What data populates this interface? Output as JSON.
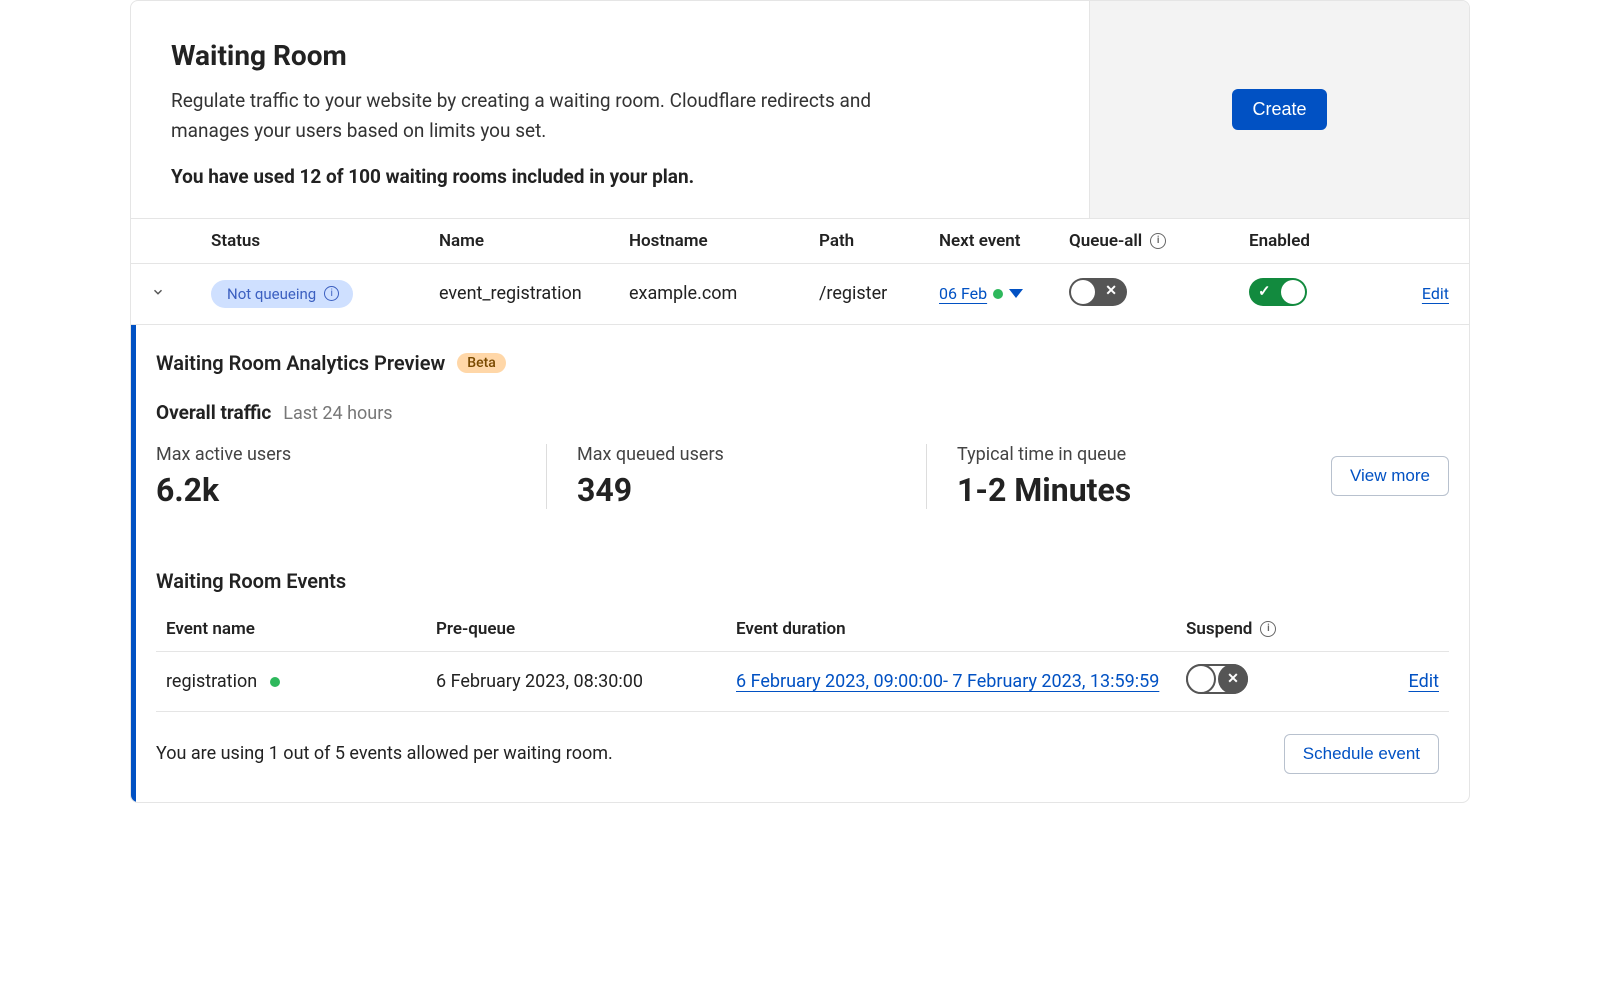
{
  "header": {
    "title": "Waiting Room",
    "description": "Regulate traffic to your website by creating a waiting room. Cloudflare redirects and manages your users based on limits you set.",
    "usage": "You have used 12 of 100 waiting rooms included in your plan.",
    "create_label": "Create"
  },
  "columns": {
    "status": "Status",
    "name": "Name",
    "hostname": "Hostname",
    "path": "Path",
    "next_event": "Next event",
    "queue_all": "Queue-all",
    "enabled": "Enabled",
    "edit": "Edit"
  },
  "room": {
    "status": "Not queueing",
    "name": "event_registration",
    "hostname": "example.com",
    "path": "/register",
    "next_event": "06 Feb",
    "queue_all_on": false,
    "enabled_on": true,
    "edit": "Edit"
  },
  "analytics": {
    "title": "Waiting Room Analytics Preview",
    "beta": "Beta",
    "overall_label": "Overall traffic",
    "overall_range": "Last 24 hours",
    "metrics": {
      "max_active_label": "Max active users",
      "max_active_value": "6.2k",
      "max_queued_label": "Max queued users",
      "max_queued_value": "349",
      "typical_label": "Typical time in queue",
      "typical_value": "1-2 Minutes"
    },
    "view_more": "View more"
  },
  "events_section": {
    "title": "Waiting Room Events",
    "columns": {
      "name": "Event name",
      "prequeue": "Pre-queue",
      "duration": "Event duration",
      "suspend": "Suspend"
    },
    "row": {
      "name": "registration",
      "prequeue": "6 February 2023, 08:30:00",
      "duration": "6 February 2023, 09:00:00- 7 February 2023, 13:59:59",
      "suspend_on": false,
      "edit": "Edit"
    },
    "footer_msg": "You are using 1 out of 5 events allowed per waiting room.",
    "schedule_btn": "Schedule event"
  }
}
